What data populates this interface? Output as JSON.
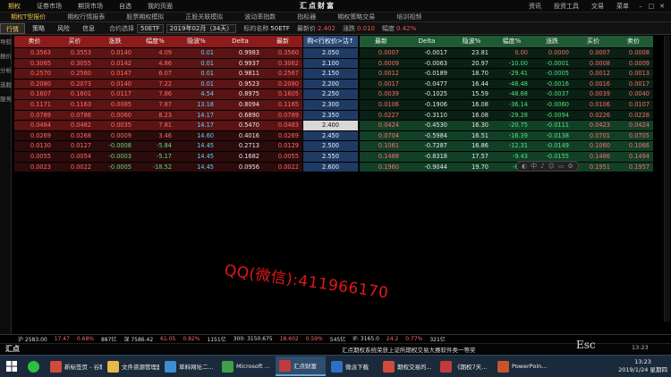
{
  "menubar": {
    "items": [
      "期权",
      "证券市场",
      "期货市场",
      "自选",
      "我的页面"
    ],
    "brand": "汇点财富",
    "right": [
      "资讯",
      "投资工具",
      "交易",
      "菜单"
    ]
  },
  "subbar": {
    "items": [
      "期权T型报价",
      "期权行情报表",
      "股票期权模拟",
      "正股关联模拟",
      "波动率指数",
      "指标器",
      "期权策略交易",
      "培训视频"
    ]
  },
  "toolbar": {
    "tabs": [
      "行情",
      "策略",
      "风险",
      "信息"
    ],
    "contract_label": "合约选择",
    "contract_value": "50ETF",
    "month_value": "2019年02月（34天）",
    "underlying_label": "标的名称",
    "underlying_value": "50ETF",
    "price_label": "最新价",
    "price_value": "2.402",
    "change_label": "涨跌",
    "change_value": "0.010",
    "pct_label": "幅度",
    "pct_value": "0.42%"
  },
  "leftnav": [
    "导航",
    "报价",
    "分析",
    "选股",
    "服务"
  ],
  "call_headers": [
    "卖价",
    "买价",
    "涨跌",
    "幅度%",
    "隐波%",
    "Delta",
    "最新"
  ],
  "strike_header": "购<行权价>沽↑",
  "put_headers": [
    "最新",
    "Delta",
    "隐波%",
    "幅度%",
    "涨跌",
    "买价",
    "卖价"
  ],
  "rows": [
    {
      "call": [
        "0.3563",
        "0.3553",
        "0.0140",
        "4.09",
        "0.01",
        "0.9983",
        "0.3560"
      ],
      "strike": "2.050",
      "put": [
        "0.0007",
        "-0.0017",
        "23.81",
        "0.00",
        "0.0000",
        "0.0007",
        "0.0008"
      ]
    },
    {
      "call": [
        "0.3065",
        "0.3055",
        "0.0142",
        "4.86",
        "0.01",
        "0.9937",
        "0.3062"
      ],
      "strike": "2.100",
      "put": [
        "0.0009",
        "-0.0063",
        "20.97",
        "-10.00",
        "-0.0001",
        "0.0008",
        "0.0009"
      ]
    },
    {
      "call": [
        "0.2570",
        "0.2560",
        "0.0147",
        "6.07",
        "0.01",
        "0.9811",
        "0.2567"
      ],
      "strike": "2.150",
      "put": [
        "0.0012",
        "-0.0189",
        "18.70",
        "-29.41",
        "-0.0005",
        "0.0012",
        "0.0013"
      ]
    },
    {
      "call": [
        "0.2080",
        "0.2073",
        "0.0140",
        "7.22",
        "0.01",
        "0.9523",
        "0.2080"
      ],
      "strike": "2.200",
      "put": [
        "0.0017",
        "-0.0477",
        "16.44",
        "-48.48",
        "-0.0016",
        "0.0016",
        "0.0017"
      ]
    },
    {
      "call": [
        "0.1607",
        "0.1601",
        "0.0117",
        "7.86",
        "4.54",
        "0.8975",
        "0.1605"
      ],
      "strike": "2.250",
      "put": [
        "0.0039",
        "-0.1025",
        "15.59",
        "-48.68",
        "-0.0037",
        "0.0039",
        "0.0040"
      ]
    },
    {
      "call": [
        "0.1171",
        "0.1163",
        "0.0085",
        "7.87",
        "13.18",
        "0.8094",
        "0.1165"
      ],
      "strike": "2.300",
      "put": [
        "0.0106",
        "-0.1906",
        "16.08",
        "-36.14",
        "-0.0060",
        "0.0106",
        "0.0107"
      ]
    },
    {
      "call": [
        "0.0789",
        "0.0786",
        "0.0060",
        "8.23",
        "14.17",
        "0.6890",
        "0.0789"
      ],
      "strike": "2.350",
      "put": [
        "0.0227",
        "-0.3110",
        "16.08",
        "-29.28",
        "-0.0094",
        "0.0226",
        "0.0228"
      ]
    },
    {
      "call": [
        "0.0484",
        "0.0482",
        "0.0035",
        "7.81",
        "14.17",
        "0.5470",
        "0.0483"
      ],
      "strike": "2.400",
      "put": [
        "0.0424",
        "-0.4530",
        "16.30",
        "-20.75",
        "-0.0111",
        "0.0423",
        "0.0424"
      ]
    },
    {
      "call": [
        "0.0269",
        "0.0268",
        "0.0009",
        "3.46",
        "14.60",
        "0.4016",
        "0.0269"
      ],
      "strike": "2.450",
      "put": [
        "0.0704",
        "-0.5984",
        "16.51",
        "-16.39",
        "-0.0138",
        "0.0701",
        "0.0705"
      ]
    },
    {
      "call": [
        "0.0130",
        "0.0127",
        "-0.0008",
        "-5.84",
        "14.45",
        "0.2713",
        "0.0129"
      ],
      "strike": "2.500",
      "put": [
        "0.1061",
        "-0.7287",
        "16.86",
        "-12.31",
        "-0.0149",
        "0.1060",
        "0.1066"
      ]
    },
    {
      "call": [
        "0.0055",
        "0.0054",
        "-0.0003",
        "-5.17",
        "14.45",
        "0.1682",
        "0.0055"
      ],
      "strike": "2.550",
      "put": [
        "0.1488",
        "-0.8318",
        "17.57",
        "-9.43",
        "-0.0155",
        "0.1486",
        "0.1494"
      ]
    },
    {
      "call": [
        "0.0023",
        "0.0022",
        "-0.0005",
        "-18.52",
        "14.45",
        "0.0956",
        "0.0022"
      ],
      "strike": "2.600",
      "put": [
        "0.1960",
        "-0.9044",
        "19.70",
        "-6.80",
        "-0.0143",
        "0.1951",
        "0.1957"
      ]
    }
  ],
  "selected_strike": "2.400",
  "watermark": "QQ(微信):411966170",
  "statusbar": {
    "items": [
      "沪 2583.00",
      "17.47",
      "0.68%",
      "887亿",
      "深 7586.42",
      "61.05",
      "0.82%",
      "1151亿",
      "300: 3150.675",
      "18.602",
      "0.59%",
      "545亿",
      "IF: 3165.0",
      "24.2",
      "0.77%",
      "321亿"
    ]
  },
  "statusbar2": {
    "logo": "汇点",
    "ticker": "汇点期权系统荣获上证所期权交易大赛软件类一等奖",
    "esc": "Esc",
    "mini_time": "13:23"
  },
  "taskbar": {
    "items": [
      {
        "label": "新标签页 - 谷歌",
        "color": "#d24a3b"
      },
      {
        "label": "文件资源管理器",
        "color": "#e8b84a"
      },
      {
        "label": "草料网址二...",
        "color": "#3b8ed2"
      },
      {
        "label": "Microsoft ...",
        "color": "#3fa04a"
      },
      {
        "label": "汇点财富",
        "color": "#c23b3b"
      },
      {
        "label": "微派下载",
        "color": "#2f6fc4"
      },
      {
        "label": "期权交易的...",
        "color": "#d24a3b"
      },
      {
        "label": "《期权7天...",
        "color": "#c23b3b"
      },
      {
        "label": "PowerPoin...",
        "color": "#c8542e"
      }
    ],
    "time": "13:23",
    "date": "2019/1/24 星期四"
  }
}
